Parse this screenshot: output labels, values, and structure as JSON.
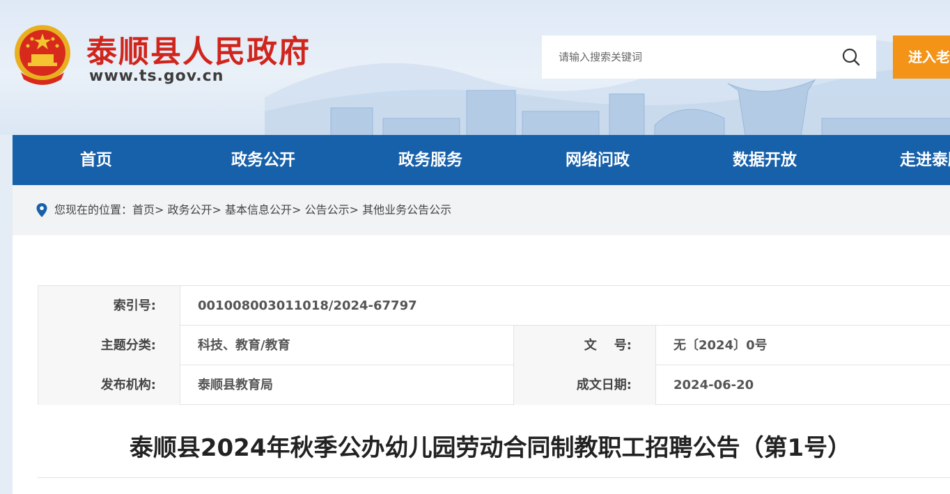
{
  "header": {
    "site_name": "泰顺县人民政府",
    "site_url": "www.ts.gov.cn",
    "search_placeholder": "请输入搜索关键词",
    "elder_mode_label": "进入老",
    "brand_red": "#d0251c",
    "accent_orange": "#f39317"
  },
  "nav": {
    "color": "#1760aa",
    "items": [
      "首页",
      "政务公开",
      "政务服务",
      "网络问政",
      "数据开放",
      "走进泰顺"
    ]
  },
  "breadcrumb": {
    "prefix": "您现在的位置：",
    "items": [
      "首页",
      "政务公开",
      "基本信息公开",
      "公告公示",
      "其他业务公告公示"
    ],
    "separator": ">"
  },
  "meta": {
    "index_label": "索引号:",
    "index_value": "001008003011018/2024-67797",
    "topic_label": "主题分类:",
    "topic_value": "科技、教育/教育",
    "doc_no_label": "文    号:",
    "doc_no_value": "无〔2024〕0号",
    "publisher_label": "发布机构:",
    "publisher_value": "泰顺县教育局",
    "date_label": "成文日期:",
    "date_value": "2024-06-20"
  },
  "article": {
    "title": "泰顺县2024年秋季公办幼儿园劳动合同制教职工招聘公告（第1号）"
  }
}
